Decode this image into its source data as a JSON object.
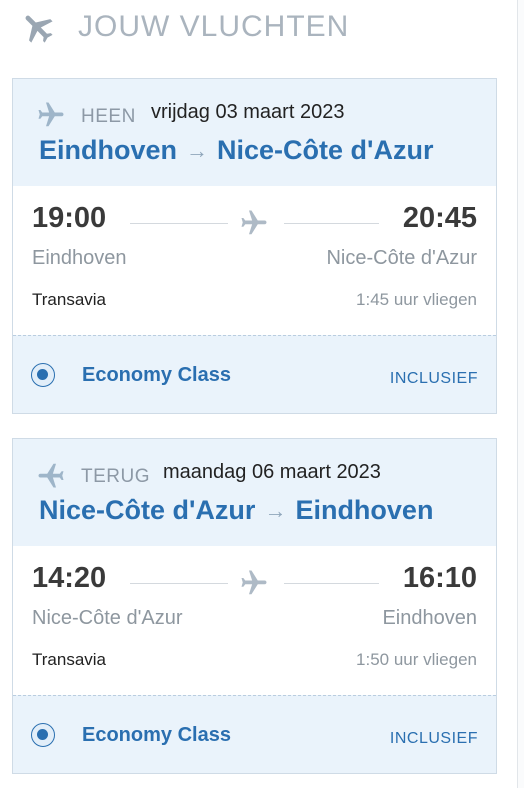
{
  "header": {
    "title": "JOUW VLUCHTEN",
    "icon": "airplane-icon"
  },
  "flights": [
    {
      "direction": "HEEN",
      "date": "vrijdag 03 maart 2023",
      "from": "Eindhoven",
      "to": "Nice-Côte d'Azur",
      "arrow": "→",
      "departure_time": "19:00",
      "arrival_time": "20:45",
      "departure_city": "Eindhoven",
      "arrival_city": "Nice-Côte d'Azur",
      "airline": "Transavia",
      "duration": "1:45 uur vliegen",
      "fare_class": "Economy Class",
      "fare_status": "INCLUSIEF",
      "selected": true
    },
    {
      "direction": "TERUG",
      "date": "maandag 06 maart 2023",
      "from": "Nice-Côte d'Azur",
      "to": "Eindhoven",
      "arrow": "→",
      "departure_time": "14:20",
      "arrival_time": "16:10",
      "departure_city": "Nice-Côte d'Azur",
      "arrival_city": "Eindhoven",
      "airline": "Transavia",
      "duration": "1:50 uur vliegen",
      "fare_class": "Economy Class",
      "fare_status": "INCLUSIEF",
      "selected": true
    }
  ],
  "colors": {
    "accent": "#2a6fb0",
    "muted": "#aab4be",
    "panel": "#eaf3fb"
  }
}
